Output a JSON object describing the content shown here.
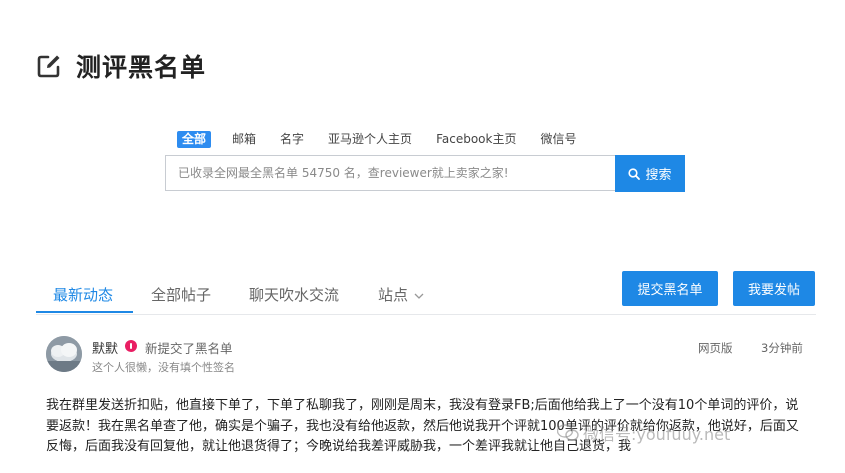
{
  "page": {
    "title": "测评黑名单"
  },
  "search": {
    "tabs": [
      {
        "label": "全部",
        "active": true
      },
      {
        "label": "邮箱"
      },
      {
        "label": "名字"
      },
      {
        "label": "亚马逊个人主页"
      },
      {
        "label": "Facebook主页"
      },
      {
        "label": "微信号"
      }
    ],
    "placeholder": "已收录全网最全黑名单 54750 名，查reviewer就上卖家之家!",
    "button_label": "搜索"
  },
  "nav": {
    "tabs": [
      {
        "label": "最新动态",
        "active": true
      },
      {
        "label": "全部帖子"
      },
      {
        "label": "聊天吹水交流"
      },
      {
        "label": "站点"
      }
    ],
    "submit_blacklist_label": "提交黑名单",
    "new_post_label": "我要发帖"
  },
  "post": {
    "author": "默默",
    "action": "新提交了黑名单",
    "signature": "这个人很懒，没有填个性签名",
    "source": "网页版",
    "time": "3分钟前",
    "body": "我在群里发送折扣贴，他直接下单了，下单了私聊我了，刚刚是周末，我没有登录FB;后面他给我上了一个没有10个单词的评价，说要返款！我在黑名单查了他，确实是个骗子，我也没有给他返款，然后他说我开个评就100单评的评价就给你返款，他说好，后面又反悔，后面我没有回复他，就让他退货得了；今晚说给我差评威胁我，一个差评我就让他自己退货，我"
  },
  "watermark": {
    "text": "微信号:youfuuy.net"
  },
  "colors": {
    "accent": "#1e88e5",
    "badge": "#e91e63"
  }
}
